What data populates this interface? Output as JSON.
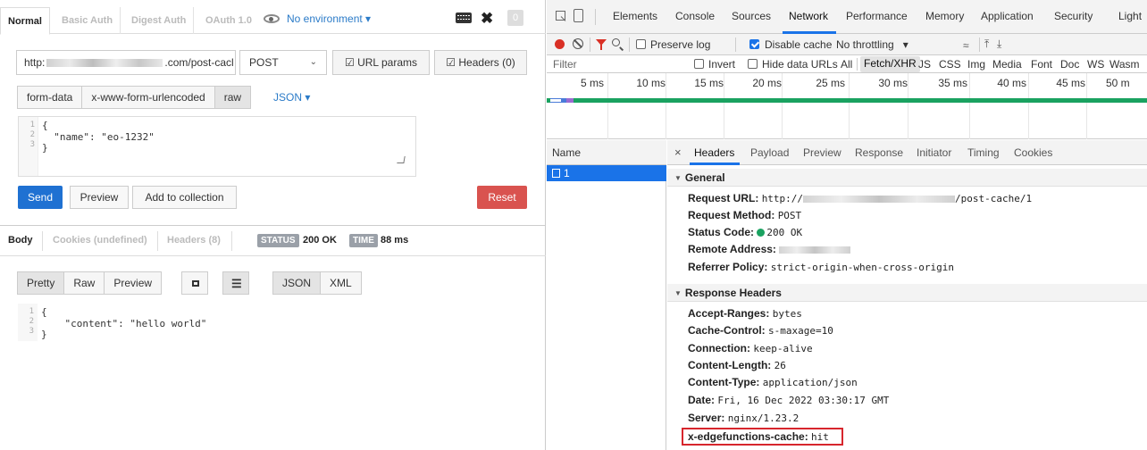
{
  "postman": {
    "tabs": [
      "Normal",
      "Basic Auth",
      "Digest Auth",
      "OAuth 1.0"
    ],
    "environment": "No environment",
    "counter": "0",
    "url_prefix": "http:",
    "url_suffix": ".com/post-cacl",
    "method": "POST",
    "url_params_label": "URL params",
    "headers_btn_label": "Headers (0)",
    "body_types": [
      "form-data",
      "x-www-form-urlencoded",
      "raw"
    ],
    "body_format": "JSON",
    "request_body_lines": [
      "{",
      "  \"name\": \"eo-1232\"",
      "}"
    ],
    "line_numbers": [
      "1",
      "2",
      "3"
    ],
    "send_label": "Send",
    "preview_label": "Preview",
    "add_collection_label": "Add to collection",
    "reset_label": "Reset",
    "response_tabs": [
      "Body",
      "Cookies (undefined)",
      "Headers (8)"
    ],
    "status_badge": "STATUS",
    "status_value": "200 OK",
    "time_badge": "TIME",
    "time_value": "88 ms",
    "view_buttons": [
      "Pretty",
      "Raw",
      "Preview"
    ],
    "format_buttons": [
      "JSON",
      "XML"
    ],
    "response_body_lines": [
      "{",
      "    \"content\": \"hello world\"",
      "}"
    ]
  },
  "devtools": {
    "tabs": [
      "Elements",
      "Console",
      "Sources",
      "Network",
      "Performance",
      "Memory",
      "Application",
      "Security",
      "Light"
    ],
    "active_tab": "Network",
    "toolbar": {
      "preserve_log": "Preserve log",
      "disable_cache": "Disable cache",
      "throttling": "No throttling"
    },
    "filter": {
      "placeholder": "Filter",
      "invert": "Invert",
      "hide_data_urls": "Hide data URLs",
      "types": [
        "All",
        "Fetch/XHR",
        "JS",
        "CSS",
        "Img",
        "Media",
        "Font",
        "Doc",
        "WS",
        "Wasm"
      ]
    },
    "timeline_ticks": [
      "5 ms",
      "10 ms",
      "15 ms",
      "20 ms",
      "25 ms",
      "30 ms",
      "35 ms",
      "40 ms",
      "45 ms",
      "50 m"
    ],
    "name_header": "Name",
    "request_name": "1",
    "detail_tabs": [
      "Headers",
      "Payload",
      "Preview",
      "Response",
      "Initiator",
      "Timing",
      "Cookies"
    ],
    "general_title": "General",
    "general": {
      "request_url_key": "Request URL:",
      "request_url_prefix": "http://",
      "request_url_suffix": "/post-cache/1",
      "method_key": "Request Method:",
      "method_val": "POST",
      "status_key": "Status Code:",
      "status_val": "200 OK",
      "remote_key": "Remote Address:",
      "referrer_key": "Referrer Policy:",
      "referrer_val": "strict-origin-when-cross-origin"
    },
    "response_headers_title": "Response Headers",
    "response_headers": [
      {
        "k": "Accept-Ranges:",
        "v": "bytes"
      },
      {
        "k": "Cache-Control:",
        "v": "s-maxage=10"
      },
      {
        "k": "Connection:",
        "v": "keep-alive"
      },
      {
        "k": "Content-Length:",
        "v": "26"
      },
      {
        "k": "Content-Type:",
        "v": "application/json"
      },
      {
        "k": "Date:",
        "v": "Fri, 16 Dec 2022 03:30:17 GMT"
      },
      {
        "k": "Server:",
        "v": "nginx/1.23.2"
      },
      {
        "k": "x-edgefunctions-cache:",
        "v": "hit"
      }
    ],
    "colors": {
      "accent": "#1a73e8",
      "record": "#d93025",
      "ok": "#1aa260",
      "highlight": "#d7262d"
    }
  }
}
